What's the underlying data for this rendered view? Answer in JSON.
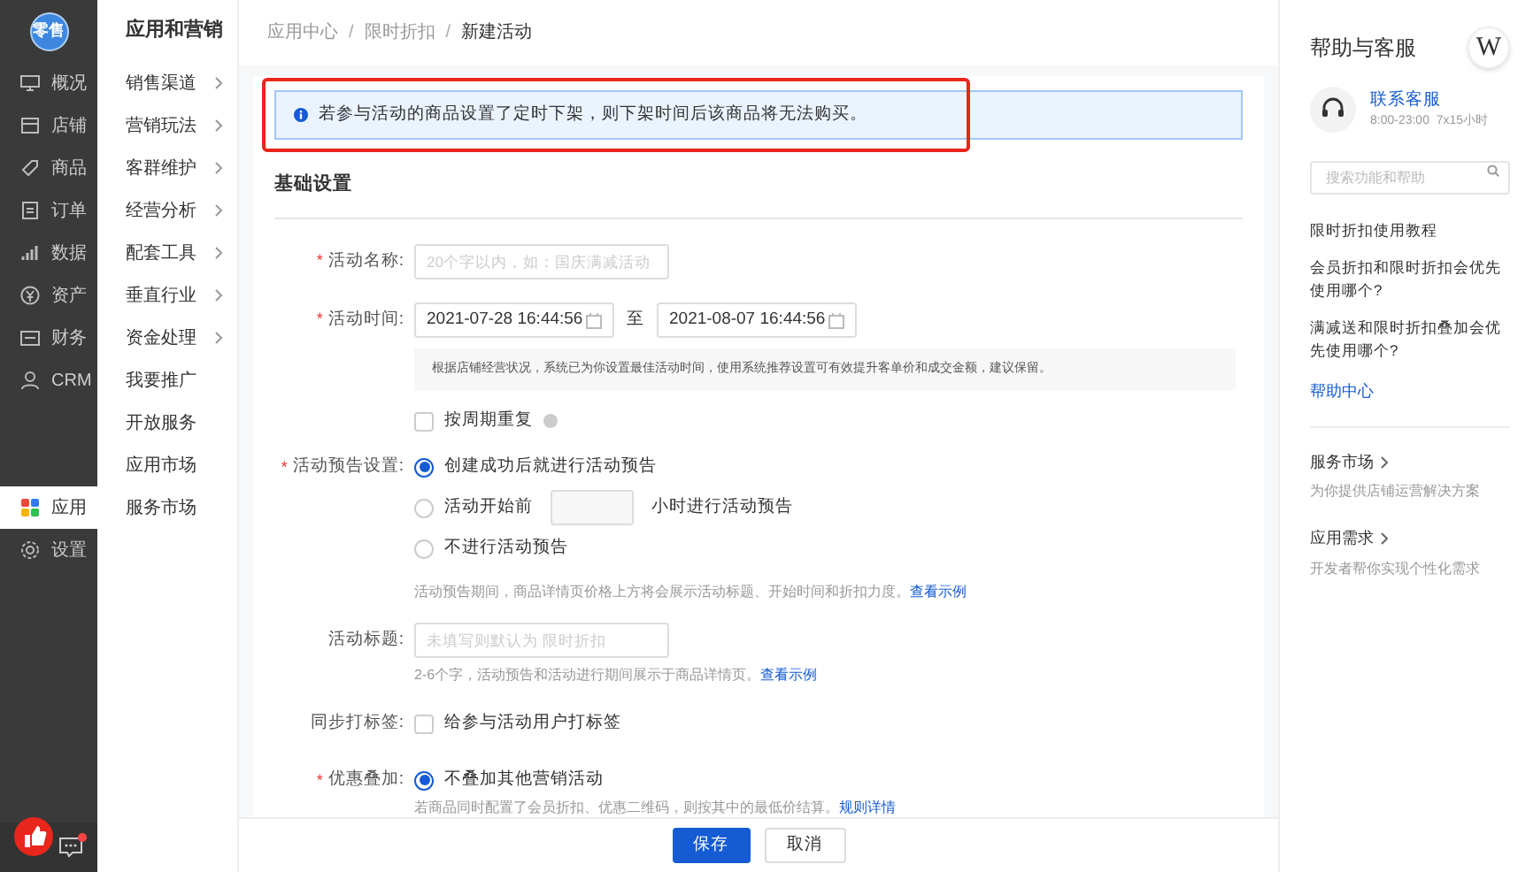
{
  "nav": {
    "logo": "零售",
    "items": [
      {
        "label": "概况",
        "selected": false
      },
      {
        "label": "店铺",
        "selected": false
      },
      {
        "label": "商品",
        "selected": false
      },
      {
        "label": "订单",
        "selected": false
      },
      {
        "label": "数据",
        "selected": false
      },
      {
        "label": "资产",
        "selected": false
      },
      {
        "label": "财务",
        "selected": false
      },
      {
        "label": "CRM",
        "selected": false
      },
      {
        "label": "应用",
        "selected": true
      },
      {
        "label": "设置",
        "selected": false
      }
    ],
    "chat_unread": true
  },
  "submenu": {
    "title": "应用和营销",
    "items": [
      {
        "label": "销售渠道",
        "has_children": true
      },
      {
        "label": "营销玩法",
        "has_children": true
      },
      {
        "label": "客群维护",
        "has_children": true
      },
      {
        "label": "经营分析",
        "has_children": true
      },
      {
        "label": "配套工具",
        "has_children": true
      },
      {
        "label": "垂直行业",
        "has_children": true
      },
      {
        "label": "资金处理",
        "has_children": true
      },
      {
        "label": "我要推广",
        "has_children": false
      },
      {
        "label": "开放服务",
        "has_children": false
      },
      {
        "label": "应用市场",
        "has_children": false
      },
      {
        "label": "服务市场",
        "has_children": false
      }
    ]
  },
  "breadcrumb": {
    "separators": [
      "/",
      "/"
    ],
    "items": [
      "应用中心",
      "限时折扣",
      "新建活动"
    ]
  },
  "notice": {
    "text": "若参与活动的商品设置了定时下架，则下架时间后该商品将无法购买。",
    "highlighted": true
  },
  "section_title": "基础设置",
  "form": {
    "required_marks": [
      "*",
      "*",
      "*",
      "*"
    ],
    "name": {
      "label": "活动名称:",
      "required": true,
      "placeholder": "20个字以内，如：国庆满减活动"
    },
    "time": {
      "label": "活动时间:",
      "required": true,
      "start": "2021-07-28 16:44:56",
      "separator": "至",
      "end": "2021-08-07 16:44:56",
      "tip": "根据店铺经营状况，系统已为你设置最佳活动时间，使用系统推荐设置可有效提升客单价和成交金额，建议保留。",
      "repeat": {
        "label": "按周期重复",
        "checked": false
      }
    },
    "preview": {
      "label": "活动预告设置:",
      "required": true,
      "options": [
        {
          "kind": "plain",
          "label": "创建成功后就进行活动预告",
          "selected": true
        },
        {
          "kind": "hours",
          "label": "活动开始前",
          "suffix": "小时进行活动预告",
          "selected": false
        },
        {
          "kind": "plain",
          "label": "不进行活动预告",
          "selected": false
        }
      ],
      "hint": "活动预告期间，商品详情页价格上方将会展示活动标题、开始时间和折扣力度。",
      "link": "查看示例"
    },
    "title": {
      "label": "活动标题:",
      "required": false,
      "placeholder": "未填写则默认为 限时折扣",
      "hint": "2-6个字，活动预告和活动进行期间展示于商品详情页。",
      "link": "查看示例"
    },
    "tagging": {
      "label": "同步打标签:",
      "required": false,
      "checkbox": "给参与活动用户打标签",
      "checked": false
    },
    "stacking": {
      "label": "优惠叠加:",
      "required": true,
      "options": [
        {
          "label": "不叠加其他营销活动",
          "selected": true
        }
      ],
      "hint": "若商品同时配置了会员折扣、优惠二维码，则按其中的最低价结算。",
      "link": "规则详情"
    }
  },
  "footer": {
    "save": "保存",
    "cancel": "取消"
  },
  "help": {
    "title": "帮助与客服",
    "logo": "W",
    "contact": "联系客服",
    "hours": "8:00-23:00  7x15小时",
    "search_placeholder": "搜索功能和帮助",
    "links": [
      "限时折扣使用教程",
      "会员折扣和限时折扣会优先使用哪个?",
      "满减送和限时折扣叠加会优先使用哪个?"
    ],
    "center": "帮助中心",
    "sections": [
      {
        "title": "服务市场",
        "desc": "为你提供店铺运营解决方案"
      },
      {
        "title": "应用需求",
        "desc": "开发者帮你实现个性化需求"
      }
    ]
  }
}
